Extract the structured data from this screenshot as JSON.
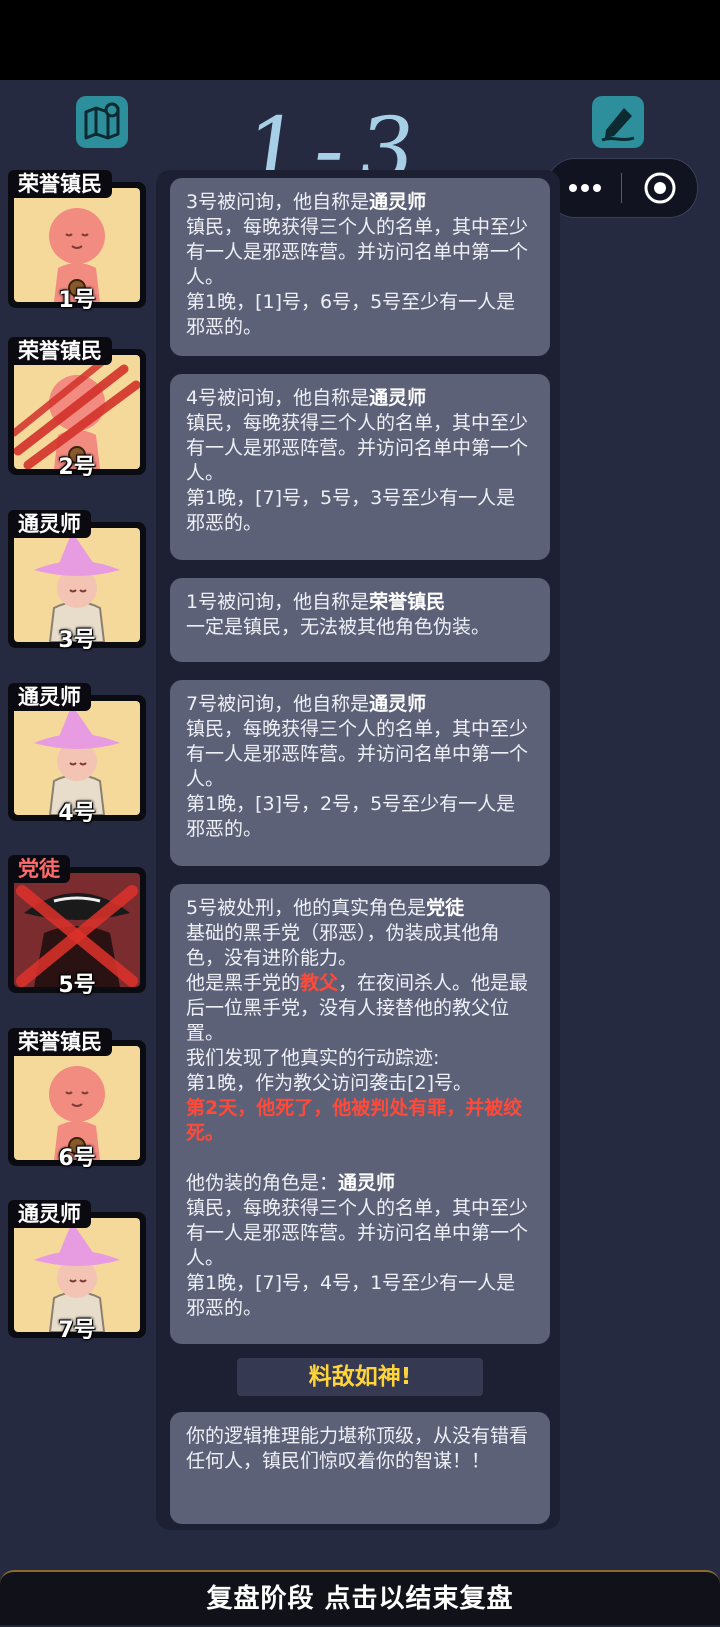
{
  "header": {
    "handwriting": "1-3",
    "map_icon": "map-icon",
    "notes_icon": "edit-icon"
  },
  "capsule": {
    "more_icon": "more-icon",
    "close_icon": "target-icon"
  },
  "players": [
    {
      "role": "荣誉镇民",
      "seat": "1号",
      "state": "alive",
      "portrait": "townsfolk-avatar"
    },
    {
      "role": "荣誉镇民",
      "seat": "2号",
      "state": "killed",
      "portrait": "townsfolk-avatar-slashed"
    },
    {
      "role": "通灵师",
      "seat": "3号",
      "state": "alive",
      "portrait": "medium-avatar"
    },
    {
      "role": "通灵师",
      "seat": "4号",
      "state": "alive",
      "portrait": "medium-avatar"
    },
    {
      "role": "党徒",
      "seat": "5号",
      "state": "executed",
      "portrait": "mobster-avatar-crossed"
    },
    {
      "role": "荣誉镇民",
      "seat": "6号",
      "state": "alive",
      "portrait": "townsfolk-avatar"
    },
    {
      "role": "通灵师",
      "seat": "7号",
      "state": "alive",
      "portrait": "medium-avatar"
    }
  ],
  "cards": {
    "c1": {
      "intro": "3号被问询，他自称是",
      "role": "通灵师",
      "l2": "镇民，每晚获得三个人的名单，其中至少有一人是邪恶阵营。并访问名单中第一个人。",
      "l3": "第1晚，[1]号，6号，5号至少有一人是邪恶的。"
    },
    "c2": {
      "intro": "4号被问询，他自称是",
      "role": "通灵师",
      "l2": "镇民，每晚获得三个人的名单，其中至少有一人是邪恶阵营。并访问名单中第一个人。",
      "l3": "第1晚，[7]号，5号，3号至少有一人是邪恶的。"
    },
    "c3": {
      "intro": "1号被问询，他自称是",
      "role": "荣誉镇民",
      "l2": "一定是镇民，无法被其他角色伪装。"
    },
    "c4": {
      "intro": "7号被问询，他自称是",
      "role": "通灵师",
      "l2": "镇民，每晚获得三个人的名单，其中至少有一人是邪恶阵营。并访问名单中第一个人。",
      "l3": "第1晚，[3]号，2号，5号至少有一人是邪恶的。"
    },
    "c5": {
      "intro": "5号被处刑，他的真实角色是",
      "role": "党徒",
      "l2": "基础的黑手党（邪恶），伪装成其他角色，没有进阶能力。",
      "l3a": "他是黑手党的",
      "l3b": "教父",
      "l3c": "，在夜间杀人。他是最后一位黑手党，没有人接替他的教父位置。",
      "l4": "我们发现了他真实的行动踪迹:",
      "l5": "第1晚，作为教父访问袭击[2]号。",
      "l6": "第2天，他死了，他被判处有罪，并被绞死。",
      "l7a": "他伪装的角色是：",
      "l7b": "通灵师",
      "l8": "镇民，每晚获得三个人的名单，其中至少有一人是邪恶阵营。并访问名单中第一个人。",
      "l9": "第1晚，[7]号，4号，1号至少有一人是邪恶的。"
    }
  },
  "verdict": "料敌如神!",
  "summary": "你的逻辑推理能力堪称顶级，从没有错看任何人，镇民们惊叹着你的智谋！！",
  "bottom_bar": "复盘阶段 点击以结束复盘",
  "colors": {
    "accent": "#2d8e9c",
    "highlight": "#ff4a3a",
    "verdict": "#ffd43b",
    "card": "#5d6178"
  }
}
